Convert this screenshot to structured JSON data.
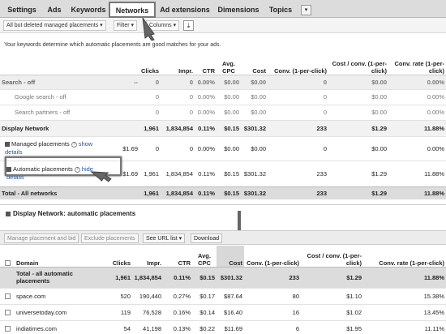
{
  "tabs": [
    "Settings",
    "Ads",
    "Keywords",
    "Networks",
    "Ad extensions",
    "Dimensions",
    "Topics"
  ],
  "filter_bar": {
    "scope": "All but deleted managed placements ▾",
    "filter": "Filter ▾",
    "columns": "Columns ▾"
  },
  "info_text": "Your keywords determine which automatic placements are good matches for your ads.",
  "table1": {
    "headers": [
      "Clicks",
      "Impr.",
      "CTR",
      "Avg. CPC",
      "Cost",
      "Conv. (1-per-click)",
      "Cost / conv. (1-per-click)",
      "Conv. rate (1-per-click)"
    ],
    "rows": [
      {
        "label": "Search - off",
        "vals": [
          "--",
          "0",
          "0",
          "0.00%",
          "$0.00",
          "$0.00",
          "0",
          "$0.00",
          "0.00%"
        ]
      },
      {
        "label": "Google search - off",
        "vals": [
          "",
          "0",
          "0",
          "0.00%",
          "$0.00",
          "$0.00",
          "0",
          "$0.00",
          "0.00%"
        ]
      },
      {
        "label": "Search partners - off",
        "vals": [
          "",
          "0",
          "0",
          "0.00%",
          "$0.00",
          "$0.00",
          "0",
          "$0.00",
          "0.00%"
        ]
      },
      {
        "label": "Display Network",
        "vals": [
          "",
          "1,961",
          "1,834,854",
          "0.11%",
          "$0.15",
          "$301.32",
          "233",
          "$1.29",
          "11.88%"
        ]
      },
      {
        "label": "Managed placements",
        "link": "show",
        "extra": "details",
        "vals": [
          "$1.69",
          "0",
          "0",
          "0.00%",
          "$0.00",
          "$0.00",
          "0",
          "$0.00",
          "0.00%"
        ]
      },
      {
        "label": "Automatic placements",
        "link": "hide",
        "extra": "details",
        "vals": [
          "$1.69",
          "1,961",
          "1,834,854",
          "0.11%",
          "$0.15",
          "$301.32",
          "233",
          "$1.29",
          "11.88%"
        ]
      }
    ],
    "total": {
      "label": "Total - All networks",
      "vals": [
        "",
        "1,961",
        "1,834,854",
        "0.11%",
        "$0.15",
        "$301.32",
        "233",
        "$1.29",
        "11.88%"
      ]
    }
  },
  "section2": {
    "title": "Display Network: automatic placements"
  },
  "toolbar2": {
    "manage": "Manage placement and bid",
    "exclude": "Exclude placements",
    "seeurl": "See URL list ▾",
    "download": "Download"
  },
  "table2": {
    "headers": [
      "Domain",
      "Clicks",
      "Impr.",
      "CTR",
      "Avg. CPC",
      "Cost",
      "Conv. (1-per-click)",
      "Cost / conv. (1-per-click)",
      "Conv. rate (1-per-click)"
    ],
    "total": {
      "label": "Total - all automatic placements",
      "vals": [
        "1,961",
        "1,834,854",
        "0.11%",
        "$0.15",
        "$301.32",
        "233",
        "$1.29",
        "11.88%"
      ]
    },
    "rows": [
      {
        "label": "space.com",
        "vals": [
          "520",
          "190,440",
          "0.27%",
          "$0.17",
          "$87.64",
          "80",
          "$1.10",
          "15.38%"
        ]
      },
      {
        "label": "universetoday.com",
        "vals": [
          "119",
          "76,528",
          "0.16%",
          "$0.14",
          "$16.40",
          "16",
          "$1.02",
          "13.45%"
        ]
      },
      {
        "label": "indiatimes.com",
        "vals": [
          "54",
          "41,198",
          "0.13%",
          "$0.22",
          "$11.69",
          "6",
          "$1.95",
          "11.11%"
        ]
      }
    ]
  }
}
